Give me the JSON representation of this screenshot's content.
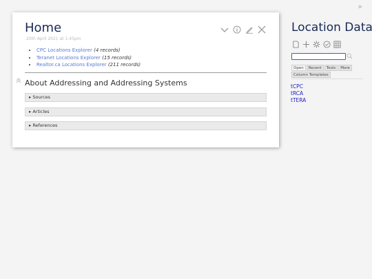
{
  "tiddler": {
    "title": "Home",
    "subtitle": "20th April 2021 at 1:45pm",
    "records": [
      {
        "link": "CPC Locations Explorer",
        "count": "(4 records)"
      },
      {
        "link": "Teranet Locations Explorer",
        "count": "(15 records)"
      },
      {
        "link": "Realtor.ca Locations Explorer",
        "count": "(211 records)"
      }
    ],
    "heading": "About Addressing and Addressing Systems",
    "sections": [
      "▸ Sources",
      "▸ Articles",
      "▸ References"
    ],
    "controls": [
      "chevron-down-icon",
      "info-icon",
      "edit-icon",
      "close-icon"
    ]
  },
  "sidebar": {
    "toggle": "»",
    "site_title": "Location Data",
    "toolbar": [
      "new-tiddler-icon",
      "plus-icon",
      "gear-icon",
      "check-circle-icon",
      "grid-icon"
    ],
    "search_value": "",
    "tabs": [
      "Open",
      "Recent",
      "Tools",
      "More"
    ],
    "tab2": "Column Templates",
    "list": [
      "tCPC",
      "tRCA",
      "tTERA"
    ]
  },
  "colors": {
    "title": "#182955",
    "link": "#5778d8",
    "sidebar_link": "#1e1ec8"
  }
}
